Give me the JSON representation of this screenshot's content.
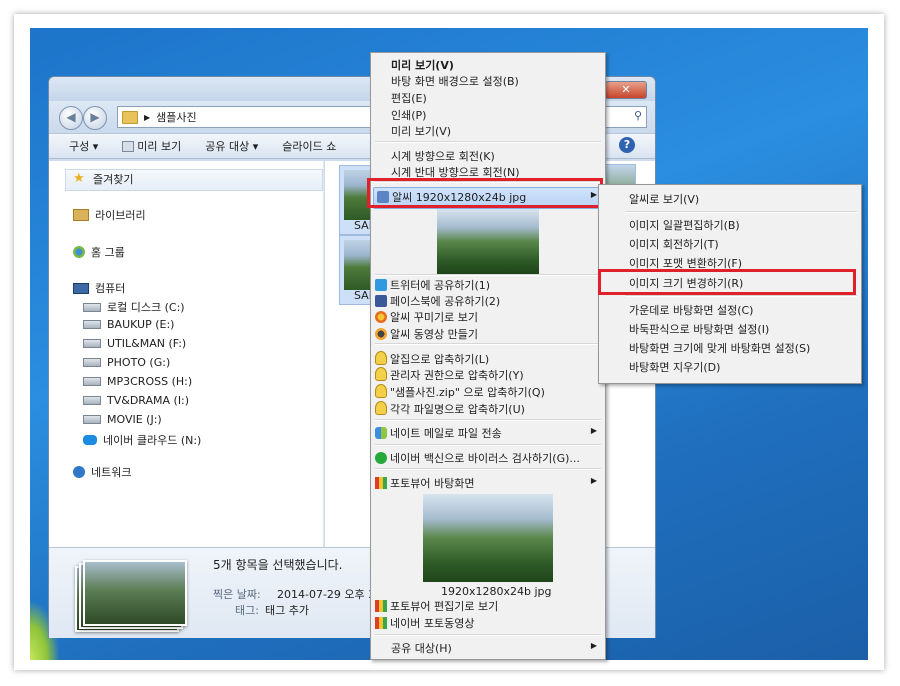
{
  "explorer": {
    "breadcrumb": "샘플사진",
    "toolbar": {
      "organize": "구성 ▾",
      "preview": "미리 보기",
      "share_with": "공유 대상 ▾",
      "slideshow": "슬라이드 쇼"
    },
    "favorites_label": "즐겨찾기",
    "nav": {
      "libraries": "라이브러리",
      "homegroup": "홈 그룹",
      "computer": "컴퓨터",
      "drives": [
        "로컬 디스크 (C:)",
        "BAUKUP (E:)",
        "UTIL&MAN (F:)",
        "PHOTO (G:)",
        "MP3CROSS (H:)",
        "TV&DRAMA (I:)",
        "MOVIE (J:)",
        "네이버 클라우드 (N:)"
      ],
      "network": "네트워크"
    },
    "thumbs": [
      {
        "label": "SAI"
      },
      {
        "label": "SAI"
      }
    ],
    "details": {
      "selected": "5개 항목을 선택했습니다.",
      "date_label": "찍은 날짜:",
      "date_value": "2014-07-29 오후 3:23",
      "tags_label": "태그:",
      "tags_value": "태그 추가"
    }
  },
  "context_menu": {
    "items_top": [
      "미리 보기(V)",
      "바탕 화면 배경으로 설정(B)",
      "편집(E)",
      "인쇄(P)",
      "미리 보기(V)"
    ],
    "rotate": [
      "시계 방향으로 회전(K)",
      "시계 반대 방향으로 회전(N)"
    ],
    "alsee_item": "알씨 1920x1280x24b jpg",
    "share": [
      "트위터에 공유하기(1)",
      "페이스북에 공유하기(2)",
      "알씨 꾸미기로 보기",
      "알씨 동영상 만들기"
    ],
    "zip": [
      "알집으로 압축하기(L)",
      "관리자 권한으로 압축하기(Y)",
      "\"샘플사진.zip\" 으로 압축하기(Q)",
      "각각 파일명으로 압축하기(U)"
    ],
    "mail": "네이트 메일로 파일 전송",
    "vaccine": "네이버 백신으로 바이러스 검사하기(G)...",
    "photoviewer_wallpaper": "포토뷰어 바탕화면",
    "image_caption": "1920x1280x24b jpg",
    "photoviewer_edit": "포토뷰어 편집기로 보기",
    "naver_photo": "네이버 포토동영상",
    "share_with": "공유 대상(H)"
  },
  "submenu": {
    "items": [
      "알씨로 보기(V)",
      "이미지 일괄편집하기(B)",
      "이미지 회전하기(T)",
      "이미지 포맷 변환하기(F)",
      "이미지 크기 변경하기(R)",
      "가운데로 바탕화면 설정(C)",
      "바둑판식으로 바탕화면 설정(I)",
      "바탕화면 크기에 맞게 바탕화면 설정(S)",
      "바탕화면 지우기(D)"
    ]
  },
  "colors": {
    "highlight_box": "#e0202b",
    "desktop": "#2b8ee0"
  }
}
